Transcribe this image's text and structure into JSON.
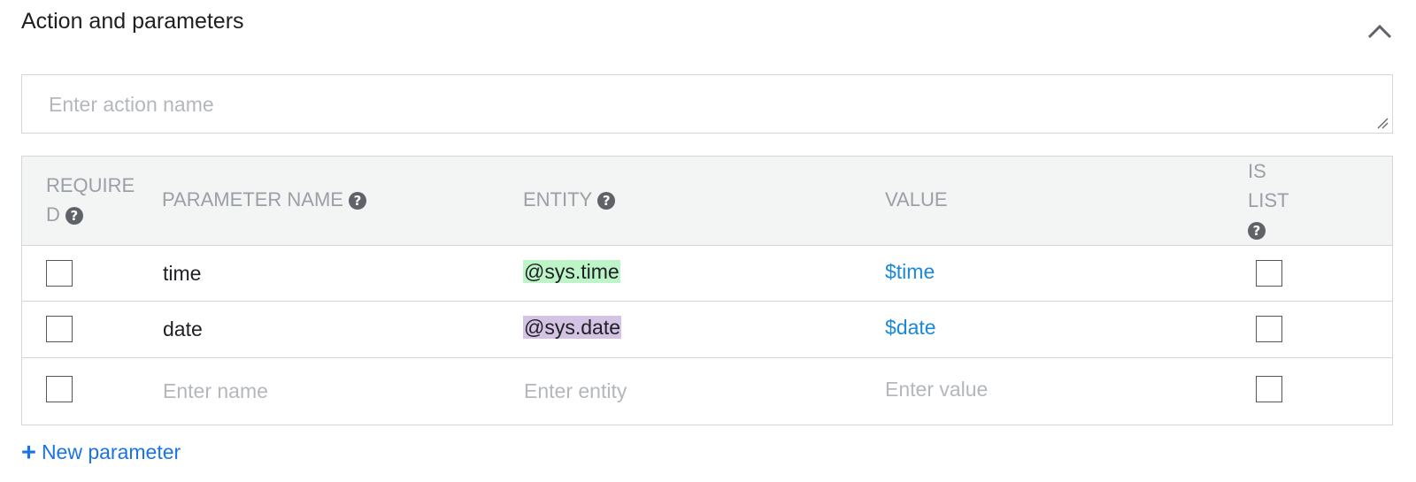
{
  "section": {
    "title": "Action and parameters"
  },
  "action": {
    "placeholder": "Enter action name"
  },
  "table": {
    "headers": {
      "required_line1": "REQUIRE",
      "required_line2": "D",
      "parameter_name": "PARAMETER NAME",
      "entity": "ENTITY",
      "value": "VALUE",
      "is_list_line1": "IS",
      "is_list_line2": "LIST"
    },
    "rows": [
      {
        "name": "time",
        "entity": "@sys.time",
        "value": "$time",
        "required": false,
        "is_list": false
      },
      {
        "name": "date",
        "entity": "@sys.date",
        "value": "$date",
        "required": false,
        "is_list": false
      }
    ],
    "new_row": {
      "name_placeholder": "Enter name",
      "entity_placeholder": "Enter entity",
      "value_placeholder": "Enter value"
    }
  },
  "new_parameter": {
    "icon": "+",
    "label": "New parameter"
  },
  "icons": {
    "help": "?",
    "collapse": "chevron-up-icon"
  },
  "colors": {
    "entity_time_highlight": "#bdf5c8",
    "entity_date_highlight": "#d5c3e6",
    "link": "#1a88d8"
  }
}
